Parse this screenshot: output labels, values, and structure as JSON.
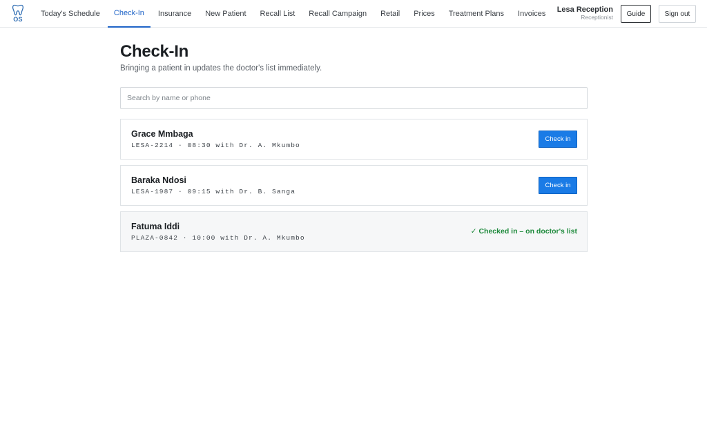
{
  "app": {
    "logo_text": "OS"
  },
  "nav": {
    "items": [
      {
        "label": "Today's Schedule",
        "active": false
      },
      {
        "label": "Check-In",
        "active": true
      },
      {
        "label": "Insurance",
        "active": false
      },
      {
        "label": "New Patient",
        "active": false
      },
      {
        "label": "Recall List",
        "active": false
      },
      {
        "label": "Recall Campaign",
        "active": false
      },
      {
        "label": "Retail",
        "active": false
      },
      {
        "label": "Prices",
        "active": false
      },
      {
        "label": "Treatment Plans",
        "active": false
      },
      {
        "label": "Invoices",
        "active": false
      }
    ]
  },
  "user": {
    "name": "Lesa Reception",
    "role": "Receptionist"
  },
  "header_buttons": {
    "guide": "Guide",
    "sign_out": "Sign out"
  },
  "page": {
    "title": "Check-In",
    "subtitle": "Bringing a patient in updates the doctor's list immediately."
  },
  "search": {
    "placeholder": "Search by name or phone",
    "value": ""
  },
  "patients": [
    {
      "name": "Grace Mmbaga",
      "meta": "LESA-2214 · 08:30 with Dr. A. Mkumbo",
      "action_label": "Check in",
      "status": ""
    },
    {
      "name": "Baraka Ndosi",
      "meta": "LESA-1987 · 09:15 with Dr. B. Sanga",
      "action_label": "Check in",
      "status": ""
    },
    {
      "name": "Fatuma Iddi",
      "meta": "PLAZA-0842 · 10:00 with Dr. A. Mkumbo",
      "action_label": "",
      "status": "✓ Checked in – on doctor's list"
    }
  ],
  "colors": {
    "accent": "#1e63c7",
    "button": "#1a7be6",
    "success": "#1e8a3c"
  }
}
